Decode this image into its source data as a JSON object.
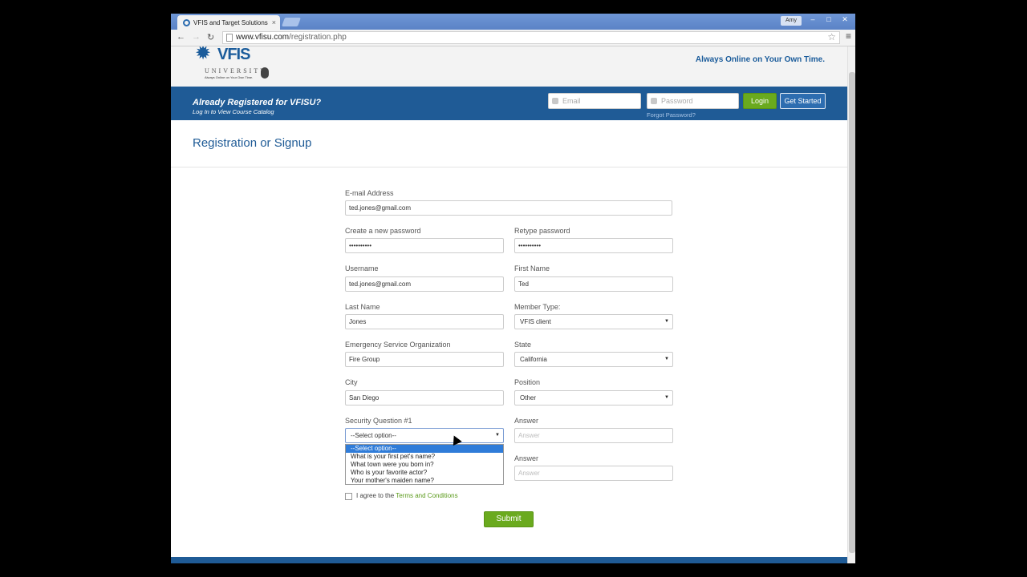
{
  "browser": {
    "tab_title": "VFIS and Target Solutions",
    "tab_close": "×",
    "user_label": "Amy",
    "url_domain": "www.vfisu.com",
    "url_path": "/registration.php",
    "win_minimize": "–",
    "win_restore": "□",
    "win_close": "✕"
  },
  "header": {
    "brand": "VFIS",
    "university": "UNIVERSITY",
    "small_tagline": "Always Online on Your Own Time.",
    "tagline": "Always Online on Your Own Time."
  },
  "bluebar": {
    "already": "Already Registered for VFISU?",
    "catalog": "Log In to View Course Catalog",
    "email_placeholder": "Email",
    "password_placeholder": "Password",
    "forgot": "Forgot Password?",
    "login": "Login",
    "get_started": "Get Started"
  },
  "main": {
    "title": "Registration or Signup"
  },
  "form": {
    "email_label": "E-mail Address",
    "email_value": "ted.jones@gmail.com",
    "password_label": "Create a new password",
    "password_value": "••••••••••",
    "retype_label": "Retype password",
    "retype_value": "••••••••••",
    "username_label": "Username",
    "username_value": "ted.jones@gmail.com",
    "firstname_label": "First Name",
    "firstname_value": "Ted",
    "lastname_label": "Last Name",
    "lastname_value": "Jones",
    "membertype_label": "Member Type:",
    "membertype_value": "VFIS client",
    "eso_label": "Emergency Service Organization",
    "eso_value": "Fire Group",
    "state_label": "State",
    "state_value": "California",
    "city_label": "City",
    "city_value": "San Diego",
    "position_label": "Position",
    "position_value": "Other",
    "sq1_label": "Security Question #1",
    "sq1_value": "--Select option--",
    "answer1_label": "Answer",
    "answer1_placeholder": "Answer",
    "answer2_label": "Answer",
    "answer2_placeholder": "Answer",
    "dropdown_options": [
      "--Select option--",
      "What is your first pet's name?",
      "What town were you born in?",
      "Who is your favorite actor?",
      "Your mother's maiden name?"
    ],
    "agree_prefix": "I agree to the",
    "agree_link": "Terms and Conditions",
    "submit": "Submit"
  }
}
